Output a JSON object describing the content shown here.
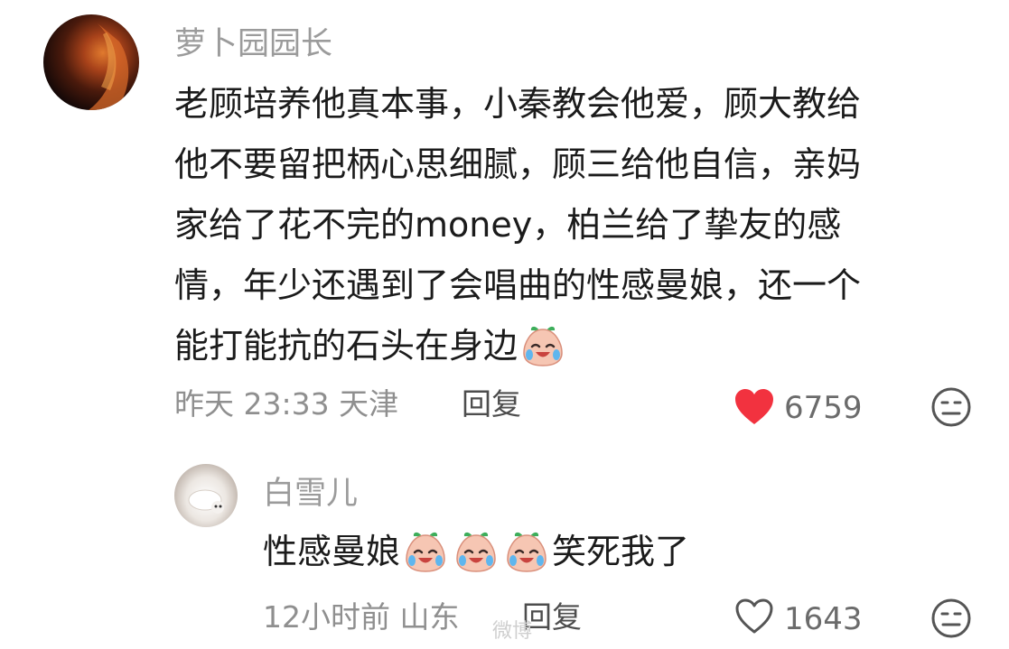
{
  "comment": {
    "username": "萝卜园园长",
    "lines": [
      "老顾培养他真本事，小秦教会他爱，顾大教给",
      "他不要留把柄心思细腻，顾三给他自信，亲妈",
      "家给了花不完的money，柏兰给了挚友的感",
      "情，年少还遇到了会唱曲的性感曼娘，还一个",
      "能打能抗的石头在身边"
    ],
    "time": "昨天 23:33 天津",
    "reply_label": "回复",
    "like_count": "6759"
  },
  "reply": {
    "username": "白雪儿",
    "text_before": "性感曼娘",
    "text_after": "笑死我了",
    "time": "12小时前 山东",
    "reply_label": "回复",
    "like_count": "1643"
  },
  "watermark": "微博",
  "icons": {
    "emoji": "laugh-cry-emoji",
    "like_filled": "heart-filled-icon",
    "like_outline": "heart-outline-icon",
    "dislike": "meh-face-icon"
  },
  "colors": {
    "heart_red": "#f2323f",
    "text": "#1b1b1b",
    "muted": "#9b9b9b"
  }
}
